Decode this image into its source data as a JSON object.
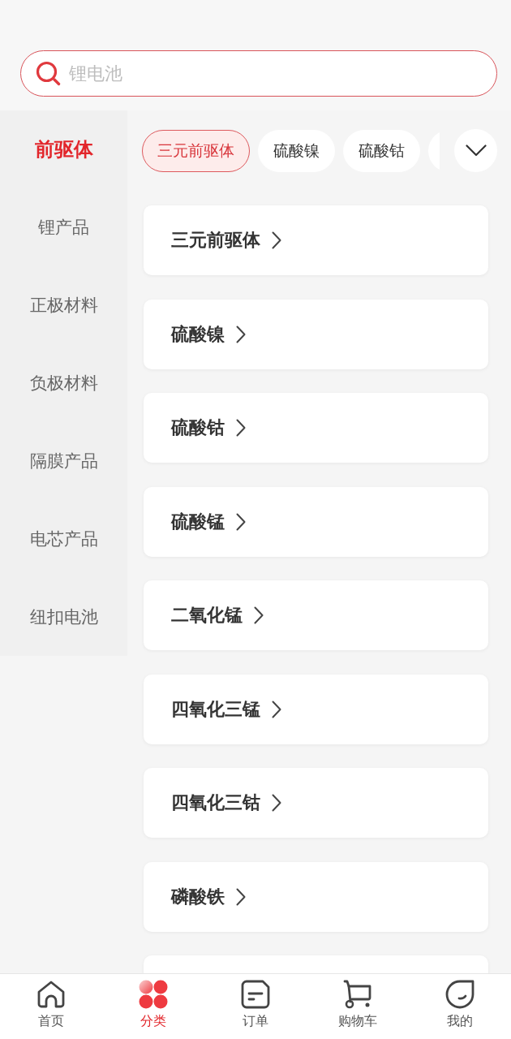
{
  "search": {
    "placeholder": "锂电池"
  },
  "sidebar": {
    "items": [
      {
        "label": "前驱体",
        "selected": true
      },
      {
        "label": "锂产品",
        "selected": false
      },
      {
        "label": "正极材料",
        "selected": false
      },
      {
        "label": "负极材料",
        "selected": false
      },
      {
        "label": "隔膜产品",
        "selected": false
      },
      {
        "label": "电芯产品",
        "selected": false
      },
      {
        "label": "纽扣电池",
        "selected": false
      }
    ]
  },
  "chips": [
    {
      "label": "三元前驱体",
      "selected": true
    },
    {
      "label": "硫酸镍",
      "selected": false
    },
    {
      "label": "硫酸钴",
      "selected": false
    }
  ],
  "cards": [
    {
      "label": "三元前驱体"
    },
    {
      "label": "硫酸镍"
    },
    {
      "label": "硫酸钴"
    },
    {
      "label": "硫酸锰"
    },
    {
      "label": "二氧化锰"
    },
    {
      "label": "四氧化三锰"
    },
    {
      "label": "四氧化三钴"
    },
    {
      "label": "磷酸铁"
    }
  ],
  "tab_bar": {
    "items": [
      {
        "label": "首页",
        "kind": "home",
        "selected": false
      },
      {
        "label": "分类",
        "kind": "category",
        "selected": true
      },
      {
        "label": "订单",
        "kind": "orders",
        "selected": false
      },
      {
        "label": "购物车",
        "kind": "cart",
        "selected": false
      },
      {
        "label": "我的",
        "kind": "profile",
        "selected": false
      }
    ]
  }
}
